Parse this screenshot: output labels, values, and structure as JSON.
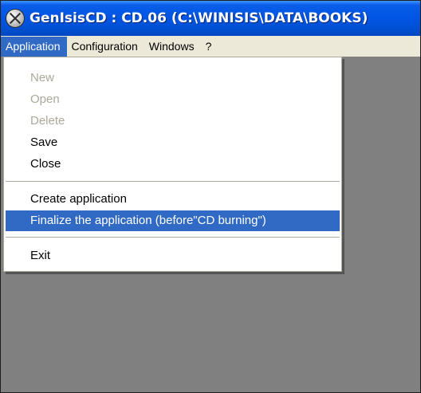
{
  "window": {
    "title": "GenIsisCD : CD.06 (C:\\WINISIS\\DATA\\BOOKS)",
    "icon": "app-globe-icon"
  },
  "menubar": {
    "items": [
      {
        "label": "Application",
        "active": true
      },
      {
        "label": "Configuration",
        "active": false
      },
      {
        "label": "Windows",
        "active": false
      },
      {
        "label": "?",
        "active": false
      }
    ]
  },
  "application_menu": {
    "items": [
      {
        "label": "New",
        "enabled": false
      },
      {
        "label": "Open",
        "enabled": false
      },
      {
        "label": "Delete",
        "enabled": false
      },
      {
        "label": "Save",
        "enabled": true
      },
      {
        "label": "Close",
        "enabled": true
      },
      {
        "label": "Create application",
        "enabled": true
      },
      {
        "label": "Finalize the application (before\"CD burning\")",
        "enabled": true,
        "selected": true
      },
      {
        "label": "Exit",
        "enabled": true
      }
    ]
  },
  "colors": {
    "titlebar": "#0055e5",
    "menubar_bg": "#ece9d8",
    "selection": "#316ac5",
    "disabled_text": "#aca899",
    "workspace": "#808080"
  }
}
